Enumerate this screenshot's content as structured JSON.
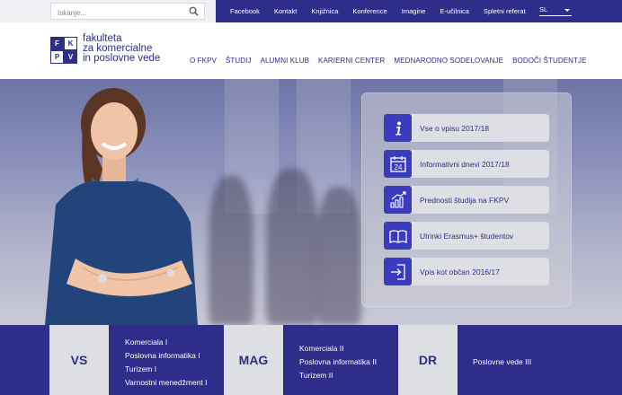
{
  "topbar": {
    "search_placeholder": "Iskanje...",
    "links": [
      "Facebook",
      "Kontakt",
      "Knjižnica",
      "Konference",
      "Imagine",
      "E-učilnica",
      "Spletni referat"
    ],
    "language": "SL"
  },
  "header": {
    "logo_letters": [
      "F",
      "K",
      "P",
      "V"
    ],
    "logo_lines": [
      "fakulteta",
      "za komercialne",
      "in poslovne vede"
    ],
    "nav": [
      "O FKPV",
      "ŠTUDIJ",
      "ALUMNI KLUB",
      "KARIERNI CENTER",
      "MEDNARODNO SODELOVANJE",
      "BODOČI ŠTUDENTJE"
    ]
  },
  "quicklinks": [
    {
      "label": "Vse o vpisu 2017/18",
      "icon": "info-icon"
    },
    {
      "label": "Informativni dnevi 2017/18",
      "icon": "calendar-icon",
      "icon_text": "24"
    },
    {
      "label": "Prednosti študija na FKPV",
      "icon": "growth-chart-icon"
    },
    {
      "label": "Utrinki Erasmus+ študentov",
      "icon": "book-icon"
    },
    {
      "label": "Vpis kot občan 2016/17",
      "icon": "enter-icon"
    }
  ],
  "programs": [
    {
      "code": "VS",
      "items": [
        "Komerciala I",
        "Poslovna informatika I",
        "Turizem I",
        "Varnostni menedžment I"
      ]
    },
    {
      "code": "MAG",
      "items": [
        "Komerciala II",
        "Poslovna informatika II",
        "Turizem II"
      ]
    },
    {
      "code": "DR",
      "items": [
        "Poslovne vede III"
      ]
    }
  ],
  "colors": {
    "brand": "#2e2d8a",
    "accent": "#3b3bc0",
    "panel_button": "#dedfe4"
  }
}
